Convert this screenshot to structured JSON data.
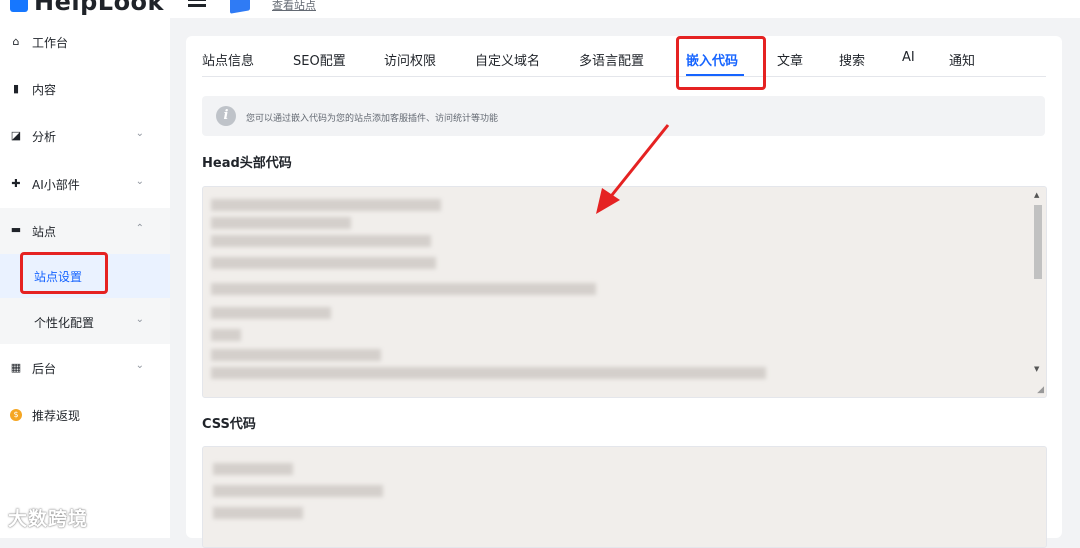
{
  "app": {
    "logo_text": "HelpLook",
    "view_site": "查看站点"
  },
  "sidebar": {
    "items": [
      {
        "label": "工作台",
        "icon": "home-icon"
      },
      {
        "label": "内容",
        "icon": "book-icon"
      },
      {
        "label": "分析",
        "icon": "chart-icon",
        "chevron": "⌄"
      },
      {
        "label": "AI小部件",
        "icon": "ai-widget-icon",
        "chevron": "⌄"
      },
      {
        "label": "站点",
        "icon": "monitor-icon",
        "chevron": "⌃"
      },
      {
        "label": "站点设置"
      },
      {
        "label": "个性化配置",
        "chevron": "⌄"
      },
      {
        "label": "后台",
        "icon": "grid-icon",
        "chevron": "⌄"
      },
      {
        "label": "推荐返现",
        "icon": "coin-icon"
      }
    ]
  },
  "tabs": [
    {
      "label": "站点信息"
    },
    {
      "label": "SEO配置"
    },
    {
      "label": "访问权限"
    },
    {
      "label": "自定义域名"
    },
    {
      "label": "多语言配置"
    },
    {
      "label": "嵌入代码"
    },
    {
      "label": "文章"
    },
    {
      "label": "搜索"
    },
    {
      "label": "AI"
    },
    {
      "label": "通知"
    }
  ],
  "notice": {
    "text": "您可以通过嵌入代码为您的站点添加客服插件、访问统计等功能",
    "icon": "info-icon"
  },
  "sections": {
    "head_title": "Head头部代码",
    "css_title": "CSS代码"
  },
  "watermark": "大数跨境",
  "colors": {
    "accent": "#1664ff",
    "highlight": "#e52222",
    "code_bg": "#f1eeeb"
  }
}
